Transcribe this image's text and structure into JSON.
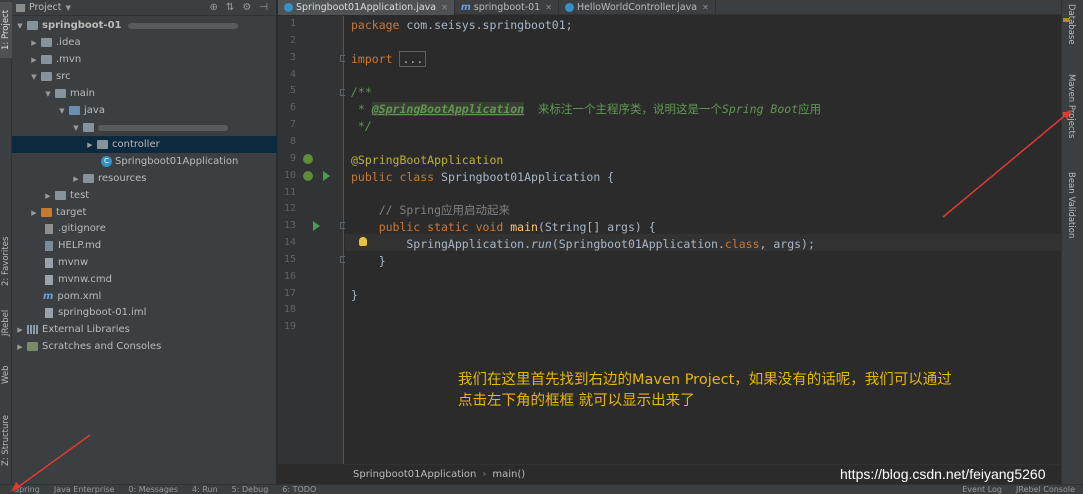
{
  "left_strip": {
    "tabs": [
      {
        "label": "1: Project"
      },
      {
        "label": "2: Favorites"
      },
      {
        "label": "JRebel"
      },
      {
        "label": "Web"
      },
      {
        "label": "Z: Structure"
      }
    ]
  },
  "project_panel": {
    "title": "Project",
    "tree": [
      {
        "label": "springboot-01",
        "type": "module"
      },
      {
        "label": ".idea",
        "type": "folder"
      },
      {
        "label": ".mvn",
        "type": "folder"
      },
      {
        "label": "src",
        "type": "folder"
      },
      {
        "label": "main",
        "type": "folder"
      },
      {
        "label": "java",
        "type": "folder-blue"
      },
      {
        "label": "",
        "type": "package-blurred"
      },
      {
        "label": "controller",
        "type": "package"
      },
      {
        "label": "Springboot01Application",
        "type": "class"
      },
      {
        "label": "resources",
        "type": "folder"
      },
      {
        "label": "test",
        "type": "folder"
      },
      {
        "label": "target",
        "type": "folder-orange"
      },
      {
        "label": ".gitignore",
        "type": "file"
      },
      {
        "label": "HELP.md",
        "type": "file"
      },
      {
        "label": "mvnw",
        "type": "file"
      },
      {
        "label": "mvnw.cmd",
        "type": "file"
      },
      {
        "label": "pom.xml",
        "type": "maven"
      },
      {
        "label": "springboot-01.iml",
        "type": "file"
      },
      {
        "label": "External Libraries",
        "type": "lib"
      },
      {
        "label": "Scratches and Consoles",
        "type": "scratch"
      }
    ]
  },
  "editor_tabs": [
    {
      "label": "Springboot01Application.java",
      "active": true
    },
    {
      "label": "springboot-01",
      "active": false
    },
    {
      "label": "HelloWorldController.java",
      "active": false
    }
  ],
  "code": {
    "line_numbers": [
      "1",
      "2",
      "3",
      "4",
      "5",
      "6",
      "7",
      "8",
      "9",
      "10",
      "11",
      "12",
      "13",
      "14",
      "15",
      "16",
      "17",
      "18",
      "19"
    ],
    "l1_kw": "package",
    "l1_rest": " com.seisys.springboot01;",
    "l3_kw": "import",
    "l3_fold": "...",
    "l6": "/**",
    "l7_star": " * ",
    "l7_tag": "@SpringBootApplication",
    "l7_text": "  来标注一个主程序类，说明这是一个",
    "l7_italic": "Spring Boot",
    "l7_end": "应用",
    "l8": " */",
    "l10": "@SpringBootApplication",
    "l11_kw": "public class",
    "l11_rest": " Springboot01Application {",
    "l13": "    // Spring应用启动起来",
    "l14_kw": "    public static void",
    "l14_fn": " main",
    "l14_rest": "(String[] args) {",
    "l15_a": "        SpringApplication.",
    "l15_fn": "run",
    "l15_b": "(Springboot01Application.",
    "l15_kw": "class",
    "l15_c": ", args);",
    "l16": "    }",
    "l18": "}"
  },
  "annotation": {
    "line1": "我们在这里首先找到右边的Maven Project，如果没有的话呢，我们可以通过",
    "line2": "点击左下角的框框 就可以显示出来了"
  },
  "breadcrumb": {
    "class": "Springboot01Application",
    "method": "main()"
  },
  "watermark": "https://blog.csdn.net/feiyang5260",
  "right_strip": {
    "tabs": [
      {
        "label": "Database"
      },
      {
        "label": "Maven Projects"
      },
      {
        "label": "Bean Validation"
      }
    ]
  },
  "bottom_bar": {
    "items": [
      "Spring",
      "Java Enterprise",
      "0: Messages",
      "4: Run",
      "5: Debug",
      "6: TODO",
      "Event Log",
      "JRebel Console"
    ]
  },
  "colors": {
    "accent_arrow": "#e03a2f",
    "annotation": "#e6b800"
  }
}
